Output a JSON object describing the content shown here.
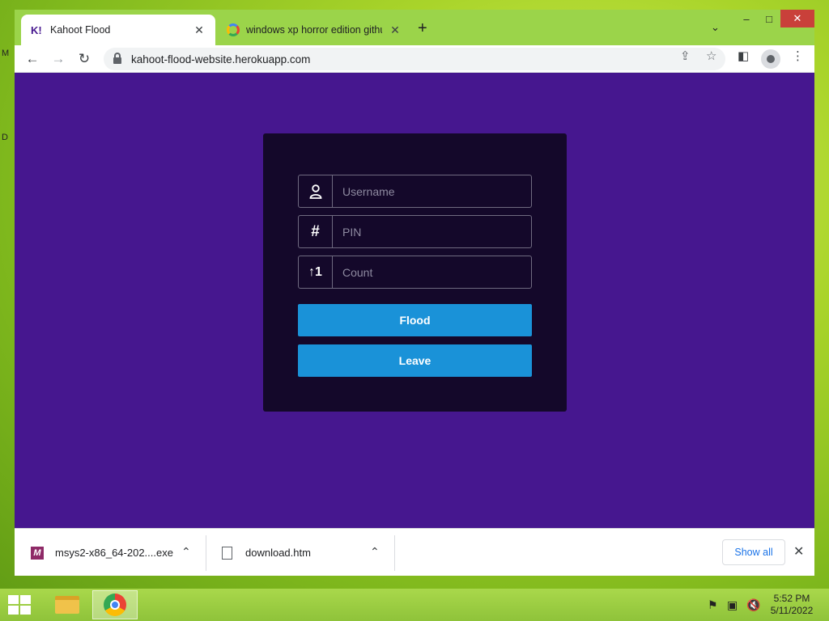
{
  "desktop": {
    "icon_labels": [
      "M",
      "D"
    ]
  },
  "browser": {
    "tabs": [
      {
        "title": "Kahoot Flood",
        "favicon": "K!",
        "active": true
      },
      {
        "title": "windows xp horror edition github",
        "favicon": "google-icon",
        "active": false
      }
    ],
    "new_tab_label": "+",
    "url": "kahoot-flood-website.herokuapp.com"
  },
  "page": {
    "background_color": "#46178f",
    "card_color": "#14082a",
    "fields": {
      "username_placeholder": "Username",
      "pin_placeholder": "PIN",
      "count_placeholder": "Count"
    },
    "buttons": {
      "flood_label": "Flood",
      "leave_label": "Leave"
    },
    "button_color": "#1a92d8"
  },
  "downloads": {
    "items": [
      {
        "name": "msys2-x86_64-202....exe"
      },
      {
        "name": "download.htm"
      }
    ],
    "show_all_label": "Show all"
  },
  "taskbar": {
    "time": "5:52 PM",
    "date": "5/11/2022"
  }
}
